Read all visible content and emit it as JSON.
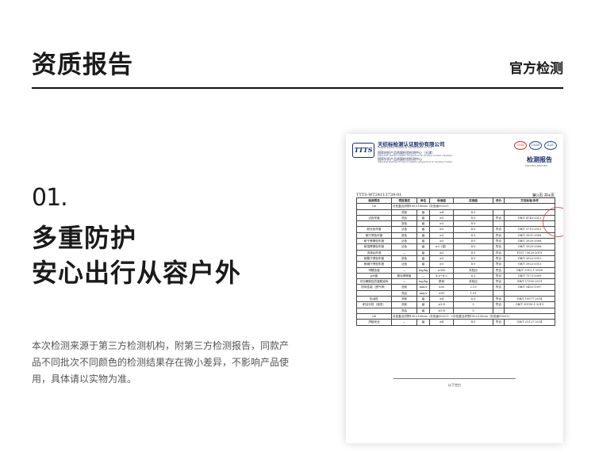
{
  "header": {
    "title": "资质报告",
    "right_label": "官方检测"
  },
  "section": {
    "number": "01.",
    "heading_line1": "多重防护",
    "heading_line2": "安心出行从容户外",
    "description": "本次检测来源于第三方检测机构，附第三方检测报告，同款产品不同批次不同颜色的检测结果存在微小差异，不影响产品使用，具体请以实物为准。"
  },
  "document": {
    "org_name": "天纺标检测认证股份有限公司",
    "org_name_en": "Tianjin Textile Testing & Certification Co.,Ltd",
    "center_line1": "国家纺织产品质量检验检测中心（天津）",
    "center_line1_en": "National Textile Quality Inspection & Testing Center (Tianjin)",
    "center_line2": "国家针织产品质量检验检测中心",
    "center_line2_en": "National Knitted Product Quality Inspection & Testing Center",
    "logo_text": "TTTS",
    "cert_marks": [
      "CMA",
      "CNAS",
      "ILAC"
    ],
    "report_title": "检测报告",
    "report_title_en": "TESTING REPORT",
    "report_number": "TTTS-WT24113739-01",
    "page_indicator": "第3页 共4页",
    "table_headers": [
      "检测项目",
      "项目描述",
      "单位",
      "标准值",
      "实测值",
      "评价",
      "方法标准/条件"
    ],
    "rows": [
      [
        "1#",
        "灰色复合织物100×100cm（灰色面00321）",
        "",
        "",
        "",
        "",
        ""
      ],
      [
        "",
        "洗前",
        "级",
        "≥4",
        "4-5",
        "",
        ""
      ],
      [
        "沾色牢度",
        "洗后",
        "级",
        "≥3",
        "4-5",
        "符合",
        "GB/T 4743-2012"
      ],
      [
        "",
        "变色",
        "级",
        "≥3",
        "4-5",
        "",
        ""
      ],
      [
        "耐光色牢度",
        "沾色",
        "级",
        "≥3",
        "4-5",
        "符合",
        "GB/T 5713-2013"
      ],
      [
        "耐汗渍色牢度",
        "变色",
        "级",
        "≥3",
        "4-5",
        "符合",
        "GB/T 3921-2008"
      ],
      [
        "耐干摩擦色牢度",
        "沾色",
        "级",
        "≥3",
        "4-5",
        "符合",
        "GB/T 3920-2008"
      ],
      [
        "耐湿摩擦色牢度",
        "沾色",
        "级",
        "≥3（湿）",
        "4-5",
        "符合",
        "GB/T 3920-2008"
      ],
      [
        "洗涤后外观",
        "—",
        "级",
        "≥3",
        "4-5",
        "符合",
        "FZ/T 73020-2019"
      ],
      [
        "耐酸汗渍色牢度",
        "变色",
        "级",
        "≥3",
        "4-5",
        "符合",
        "GB/T 3922-2013"
      ],
      [
        "耐碱汗渍色牢度",
        "沾色",
        "级",
        "≥3",
        "4-5",
        "符合",
        "GB/T 3922-2013"
      ],
      [
        "甲醛含量",
        "—",
        "mg/kg",
        "≤300",
        "未检出",
        "符合",
        "GB/T 2912.1-2009"
      ],
      [
        "pH值",
        "氯化钾萃取",
        "—",
        "4.0~8.5",
        "6.3",
        "符合",
        "GB/T 7573-2009"
      ],
      [
        "可分解致癌芳香胺染料",
        "—",
        "mg/kg",
        "禁用",
        "未检出",
        "符合",
        "GB/T 17592-2011"
      ],
      [
        "防风性能（透气率）",
        "洗前",
        "mm/s",
        "≤50",
        "2.19",
        "符合",
        "GB/T 5453-1997"
      ],
      [
        "",
        "洗后",
        "mm/s",
        "≤50",
        "1.91",
        "",
        ""
      ],
      [
        "拒油性",
        "洗前",
        "级",
        "≥4",
        "6.0",
        "符合",
        "GB/T 19977-2014"
      ],
      [
        "耐沾污性（液态）",
        "洗前",
        "级",
        "≥3-4",
        "5",
        "符合",
        "GB/T 30159.1-2013"
      ],
      [
        "",
        "洗后",
        "级",
        "≥3-4",
        "5",
        "",
        ""
      ],
      [
        "2#",
        "灰色复合织物100×100cm（灰色面00321）×灰色复合织物100×100cm（灰色面00322）",
        "",
        "",
        "",
        "",
        ""
      ],
      [
        "拼接安全",
        "—",
        "级",
        "≥4",
        "4-5",
        "符合",
        "GB/T 31127-2014"
      ]
    ],
    "footer_text": "以下空白"
  }
}
